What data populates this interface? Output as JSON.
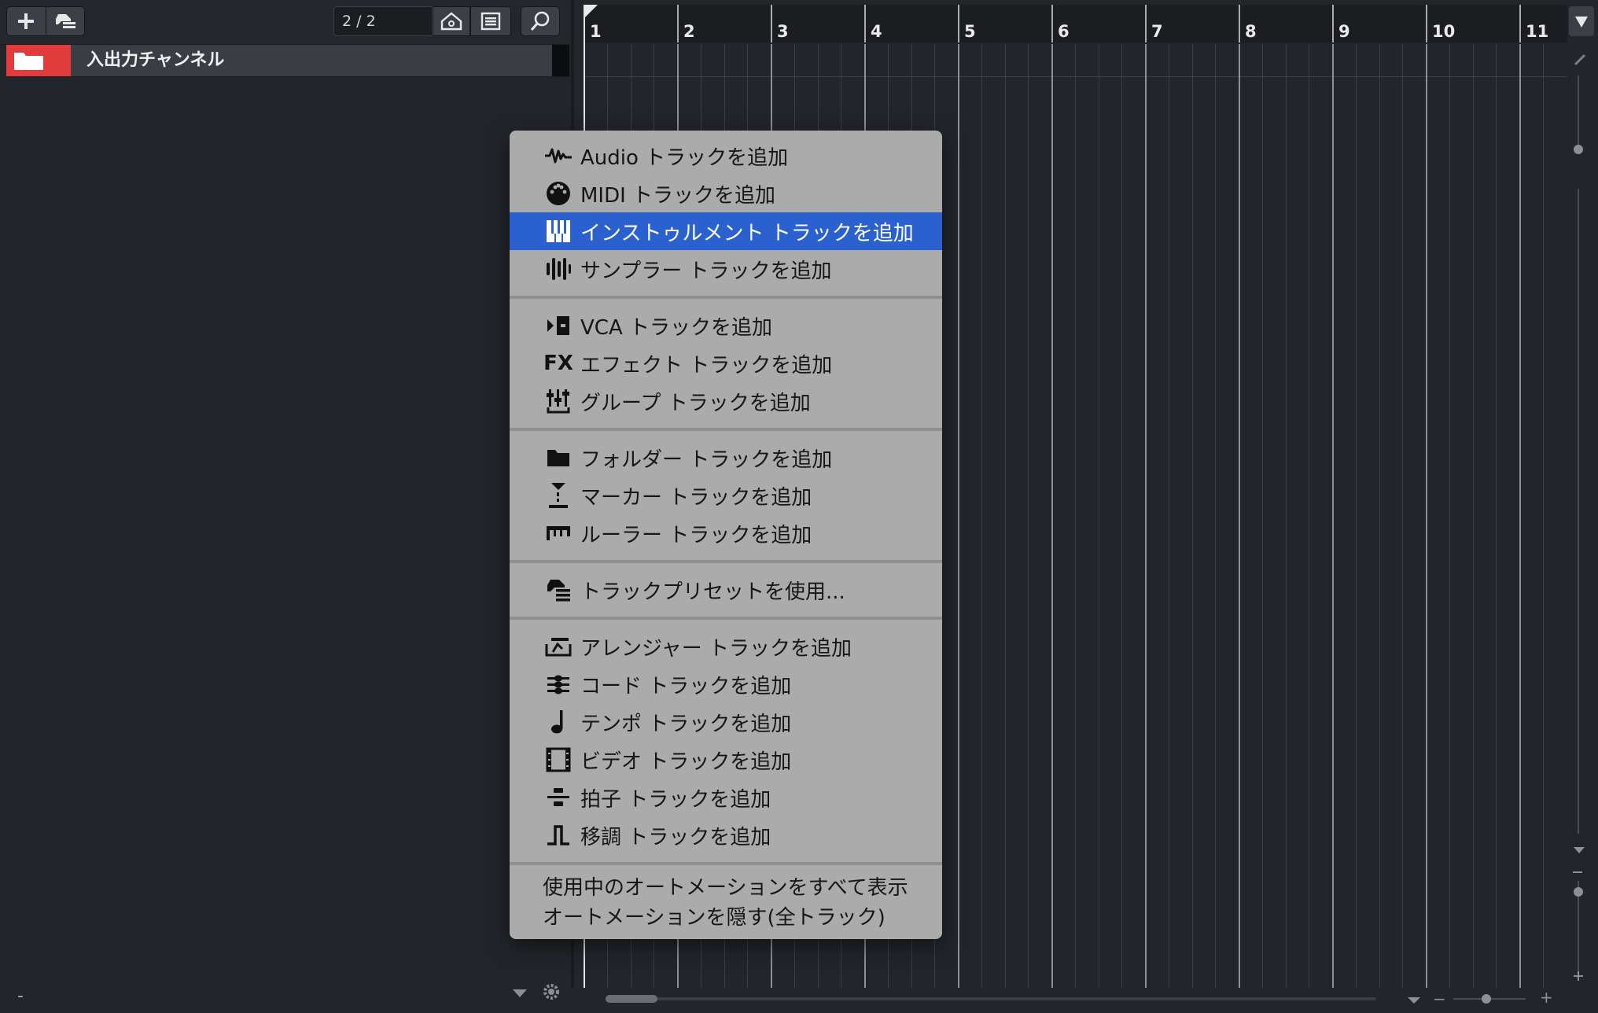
{
  "toolbar": {
    "add_label": "+",
    "counter": "2 / 2"
  },
  "track": {
    "name": "入出力チャンネル"
  },
  "ruler": {
    "bars": [
      "1",
      "2",
      "3",
      "4",
      "5",
      "6",
      "7",
      "8",
      "9",
      "10",
      "11"
    ]
  },
  "menu": {
    "items": [
      {
        "label": "Audio トラックを追加",
        "icon": "audio-waveform-icon"
      },
      {
        "label": "MIDI トラックを追加",
        "icon": "midi-port-icon"
      },
      {
        "label": "インストゥルメント トラックを追加",
        "icon": "piano-keys-icon",
        "selected": true
      },
      {
        "label": "サンプラー トラックを追加",
        "icon": "sampler-icon"
      },
      {
        "label": "VCA トラックを追加",
        "icon": "vca-icon"
      },
      {
        "label": "エフェクト トラックを追加",
        "icon": "fx-icon"
      },
      {
        "label": "グループ トラックを追加",
        "icon": "group-faders-icon"
      },
      {
        "label": "フォルダー トラックを追加",
        "icon": "folder-icon"
      },
      {
        "label": "マーカー トラックを追加",
        "icon": "marker-icon"
      },
      {
        "label": "ルーラー トラックを追加",
        "icon": "ruler-icon"
      },
      {
        "label": "トラックプリセットを使用...",
        "icon": "track-preset-icon"
      },
      {
        "label": "アレンジャー トラックを追加",
        "icon": "arranger-icon"
      },
      {
        "label": "コード トラックを追加",
        "icon": "chord-icon"
      },
      {
        "label": "テンポ トラックを追加",
        "icon": "tempo-note-icon"
      },
      {
        "label": "ビデオ トラックを追加",
        "icon": "video-film-icon"
      },
      {
        "label": "拍子 トラックを追加",
        "icon": "signature-icon"
      },
      {
        "label": "移調 トラックを追加",
        "icon": "transpose-icon"
      }
    ],
    "footer": [
      "使用中のオートメーションをすべて表示",
      "オートメーションを隠す(全トラック)"
    ],
    "fx_glyph": "FX"
  },
  "bottom": {
    "minus": "-",
    "zoom_minus": "−",
    "zoom_plus": "+"
  },
  "colors": {
    "selection": "#2b60cf",
    "track_color": "#e23b3b",
    "menu_bg": "#ababab"
  }
}
